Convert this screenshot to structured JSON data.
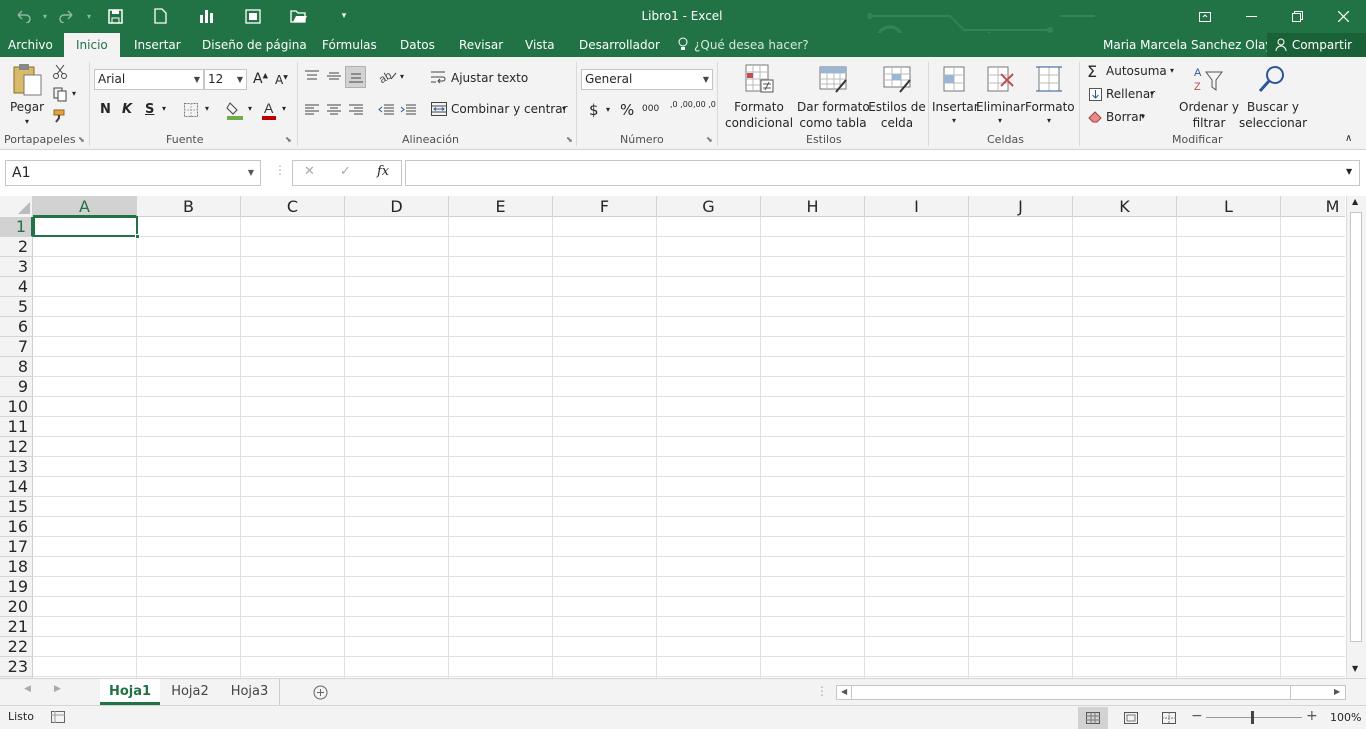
{
  "window": {
    "title": "Libro1 - Excel"
  },
  "tabs": [
    "Archivo",
    "Inicio",
    "Insertar",
    "Diseño de página",
    "Fórmulas",
    "Datos",
    "Revisar",
    "Vista",
    "Desarrollador"
  ],
  "active_tab": "Inicio",
  "tell_me": "¿Qué desea hacer?",
  "user": {
    "name": "Maria Marcela Sanchez Olaya",
    "share_label": "Compartir"
  },
  "ribbon": {
    "clipboard": {
      "label": "Portapapeles",
      "paste": "Pegar"
    },
    "font": {
      "label": "Fuente",
      "name": "Arial",
      "size": "12",
      "bold": "N",
      "italic": "K",
      "underline": "S",
      "font_color": "#c00000",
      "fill_color": "#ffc000"
    },
    "alignment": {
      "label": "Alineación",
      "wrap": "Ajustar texto",
      "merge": "Combinar y centrar"
    },
    "number": {
      "label": "Número",
      "format": "General",
      "currency": "$",
      "percent": "%",
      "thousands": "000",
      "inc_dec": ",0 ,00",
      "dec_dec": ",00 ,0"
    },
    "styles": {
      "label": "Estilos",
      "cond_format_1": "Formato",
      "cond_format_2": "condicional",
      "table_format_1": "Dar formato",
      "table_format_2": "como tabla",
      "cell_styles_1": "Estilos de",
      "cell_styles_2": "celda"
    },
    "cells": {
      "label": "Celdas",
      "insert": "Insertar",
      "delete": "Eliminar",
      "format": "Formato"
    },
    "editing": {
      "label": "Modificar",
      "autosum": "Autosuma",
      "fill": "Rellenar",
      "clear": "Borrar",
      "sort_1": "Ordenar y",
      "sort_2": "filtrar",
      "find_1": "Buscar y",
      "find_2": "seleccionar"
    }
  },
  "formula_bar": {
    "name_box": "A1",
    "cancel": "✕",
    "enter": "✓",
    "fx": "fx",
    "value": ""
  },
  "columns": [
    "A",
    "B",
    "C",
    "D",
    "E",
    "F",
    "G",
    "H",
    "I",
    "J",
    "K",
    "L",
    "M"
  ],
  "rows": [
    "1",
    "2",
    "3",
    "4",
    "5",
    "6",
    "7",
    "8",
    "9",
    "10",
    "11",
    "12",
    "13",
    "14",
    "15",
    "16",
    "17",
    "18",
    "19",
    "20",
    "21",
    "22",
    "23"
  ],
  "selected_cell": "A1",
  "sheets": [
    "Hoja1",
    "Hoja2",
    "Hoja3"
  ],
  "active_sheet": "Hoja1",
  "status": {
    "ready": "Listo",
    "zoom": "100%"
  },
  "colors": {
    "accent": "#217346"
  }
}
